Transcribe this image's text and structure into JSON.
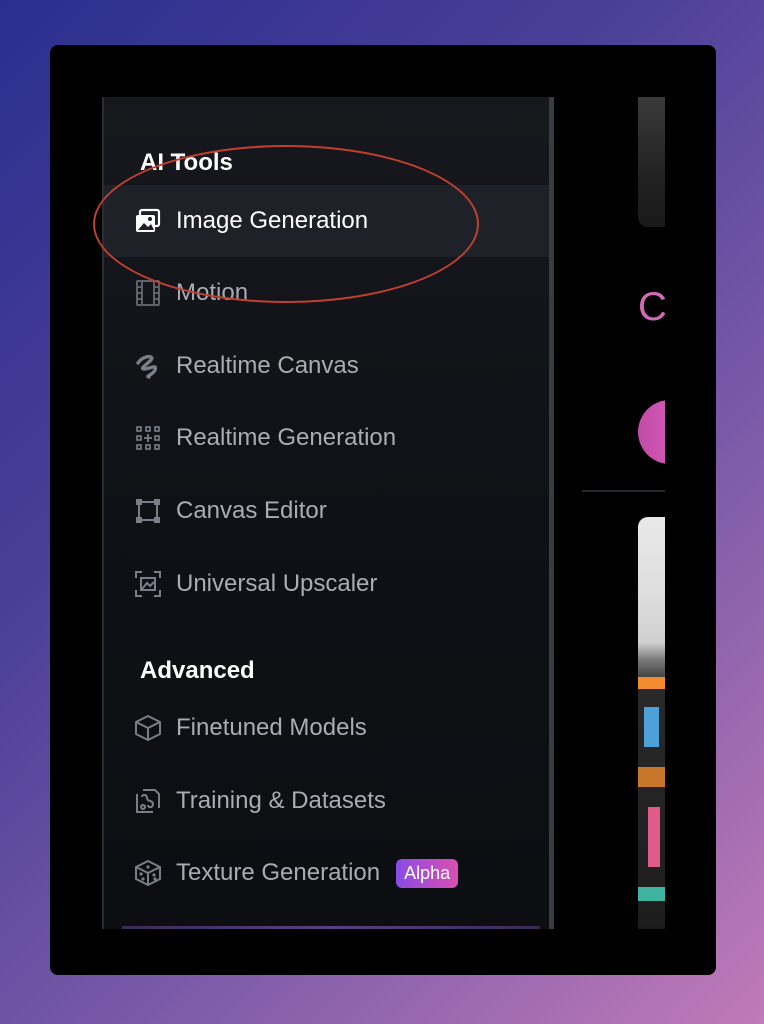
{
  "sidebar": {
    "sections": [
      {
        "title": "AI Tools",
        "items": [
          {
            "label": "Image Generation",
            "icon": "images-icon"
          },
          {
            "label": "Motion",
            "icon": "film-icon"
          },
          {
            "label": "Realtime Canvas",
            "icon": "scribble-icon"
          },
          {
            "label": "Realtime Generation",
            "icon": "dot-grid-icon"
          },
          {
            "label": "Canvas Editor",
            "icon": "frame-icon"
          },
          {
            "label": "Universal Upscaler",
            "icon": "upscale-icon"
          }
        ]
      },
      {
        "title": "Advanced",
        "items": [
          {
            "label": "Finetuned Models",
            "icon": "cube-icon"
          },
          {
            "label": "Training & Datasets",
            "icon": "training-icon"
          },
          {
            "label": "Texture Generation",
            "icon": "dice-icon",
            "badge": "Alpha"
          }
        ]
      }
    ],
    "active_item": "Image Generation"
  },
  "content": {
    "partial_heading": "C"
  },
  "colors": {
    "accent_pink": "#d26ab8",
    "highlight_ring": "#c0402f",
    "badge_gradient_start": "#8a4be8",
    "badge_gradient_end": "#d94fb0"
  }
}
